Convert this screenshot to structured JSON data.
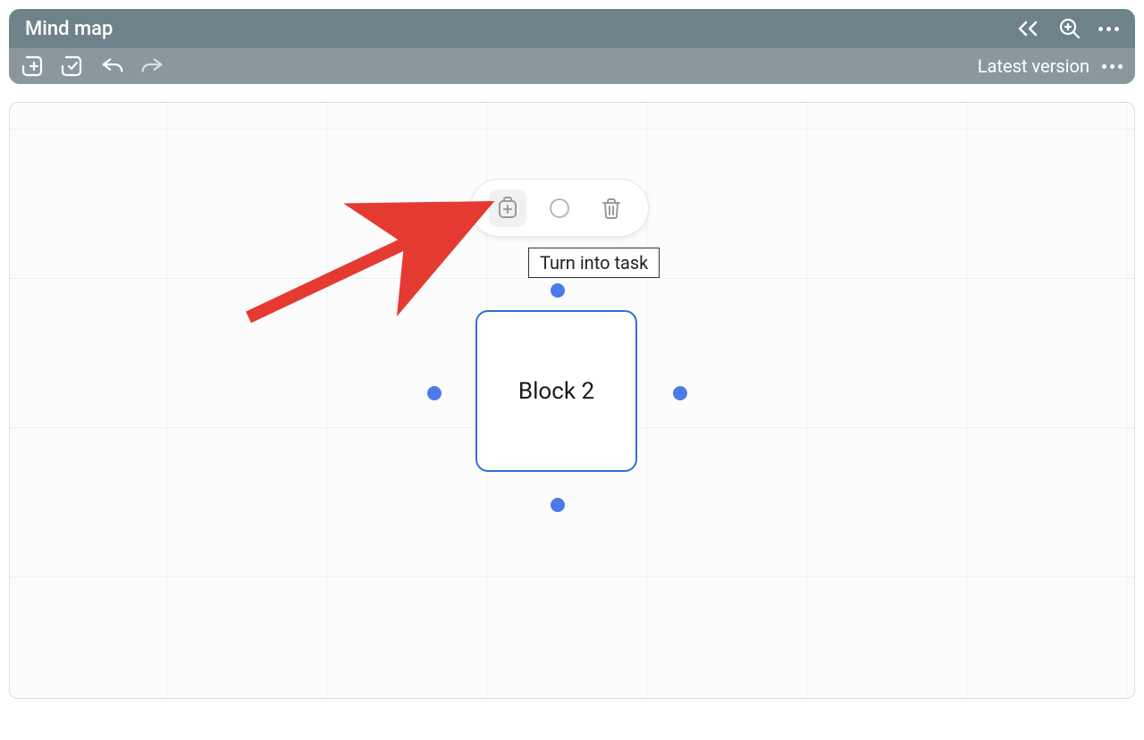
{
  "header": {
    "title": "Mind map",
    "version_label": "Latest version"
  },
  "block": {
    "label": "Block 2"
  },
  "tooltip": {
    "text": "Turn into task"
  }
}
